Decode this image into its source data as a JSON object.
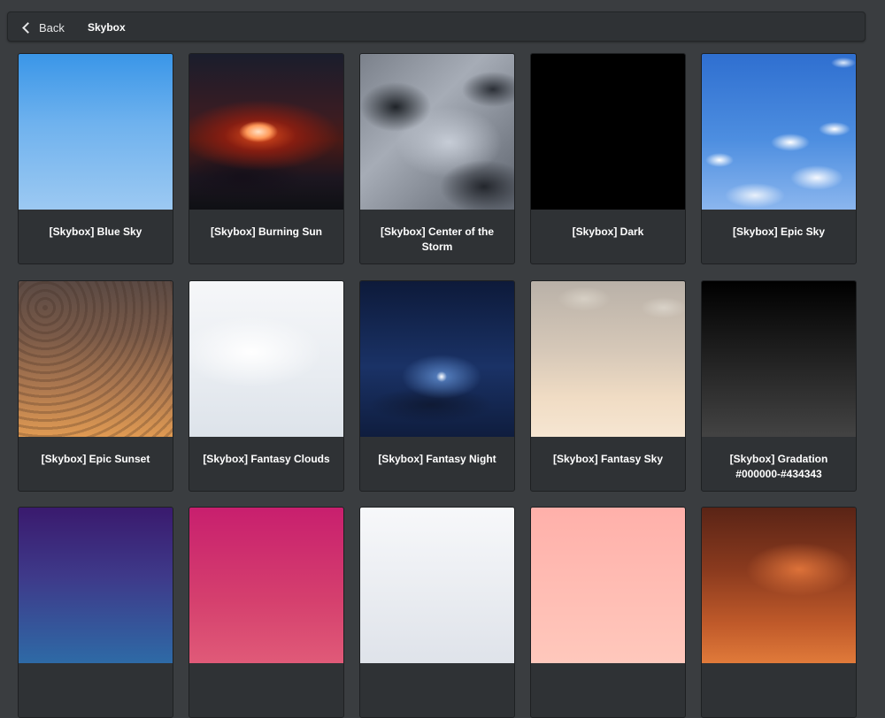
{
  "header": {
    "back_label": "Back",
    "breadcrumb": "Skybox"
  },
  "cards": [
    {
      "label": "[Skybox] Blue Sky",
      "thumb": "blue-sky"
    },
    {
      "label": "[Skybox] Burning Sun",
      "thumb": "burning-sun"
    },
    {
      "label": "[Skybox] Center of the Storm",
      "thumb": "center-of-the-storm"
    },
    {
      "label": "[Skybox] Dark",
      "thumb": "dark"
    },
    {
      "label": "[Skybox] Epic Sky",
      "thumb": "epic-sky"
    },
    {
      "label": "[Skybox] Epic Sunset",
      "thumb": "epic-sunset"
    },
    {
      "label": "[Skybox] Fantasy Clouds",
      "thumb": "fantasy-clouds"
    },
    {
      "label": "[Skybox] Fantasy Night",
      "thumb": "fantasy-night"
    },
    {
      "label": "[Skybox] Fantasy Sky",
      "thumb": "fantasy-sky"
    },
    {
      "label": "[Skybox] Gradation #000000-#434343",
      "thumb": "gradation-000000-434343"
    },
    {
      "label": "",
      "thumb": "purple-blue-gradient"
    },
    {
      "label": "",
      "thumb": "pink-gradient"
    },
    {
      "label": "",
      "thumb": "white-gradient"
    },
    {
      "label": "",
      "thumb": "salmon-gradient"
    },
    {
      "label": "",
      "thumb": "fiery-clouds"
    }
  ]
}
